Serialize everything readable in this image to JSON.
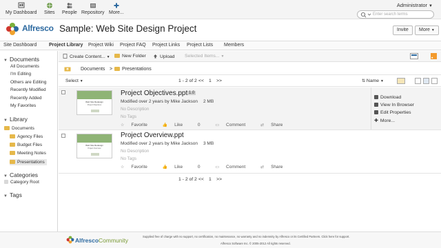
{
  "topnav": {
    "items": [
      {
        "label": "My Dashboard",
        "icon": "dashboard-icon"
      },
      {
        "label": "Sites",
        "icon": "sites-icon"
      },
      {
        "label": "People",
        "icon": "people-icon"
      },
      {
        "label": "Repository",
        "icon": "repository-icon"
      },
      {
        "label": "More...",
        "icon": "more-icon"
      }
    ],
    "user": "Administrator",
    "search_placeholder": "Enter search terms"
  },
  "header": {
    "logo_text": "Alfresco",
    "site_title": "Sample: Web Site Design Project",
    "invite_label": "Invite",
    "more_label": "More"
  },
  "sitenav": {
    "items": [
      "Site Dashboard",
      "Project Library",
      "Project Wiki",
      "Project FAQ",
      "Project Links",
      "Project Lists",
      "Members"
    ],
    "active": "Project Library"
  },
  "sidebar": {
    "documents_title": "Documents",
    "doc_filters": [
      "All Documents",
      "I'm Editing",
      "Others are Editing",
      "Recently Modified",
      "Recently Added",
      "My Favorites"
    ],
    "library_title": "Library",
    "library_root": "Documents",
    "folders": [
      "Agency Files",
      "Budget Files",
      "Meeting Notes",
      "Presentations"
    ],
    "selected_folder": "Presentations",
    "categories_title": "Categories",
    "category_root": "Category Root",
    "tags_title": "Tags"
  },
  "toolbar": {
    "create": "Create Content...",
    "new_folder": "New Folder",
    "upload": "Upload",
    "selected_items": "Selected Items..."
  },
  "path": {
    "root": "Documents",
    "current": "Presentations"
  },
  "listbar": {
    "select": "Select",
    "paging": "1 - 2 of 2",
    "prev": "<<",
    "page": "1",
    "next": ">>",
    "sort": "Name"
  },
  "files": [
    {
      "name": "Project Objectives.ppt",
      "version": "1.0",
      "modified": "Modified over 2 years by Mike Jackson",
      "size": "2 MB",
      "description": "No Description",
      "tags": "No Tags",
      "thumb_title": "Web Site Redesign",
      "thumb_subtitle": "Project Objectives"
    },
    {
      "name": "Project Overview.ppt",
      "modified": "Modified over 2 years by Mike Jackson",
      "size": "3 MB",
      "description": "No Description",
      "tags": "No Tags",
      "thumb_title": "Web Site Redesign",
      "thumb_subtitle": "Project Overview"
    }
  ],
  "row_actions": {
    "favorite": "Favorite",
    "like": "Like",
    "like_count": "0",
    "comment": "Comment",
    "share": "Share"
  },
  "action_panel": [
    "Download",
    "View In Browser",
    "Edit Properties",
    "More..."
  ],
  "footer": {
    "brand": "Alfresco",
    "brand_suffix": "Community",
    "line1": "Supplied free of charge with no support, no certification, no maintenance, no warranty and no indemnity by Alfresco or its Certified Partners. Click here for support.",
    "line2": "Alfresco Software Inc. © 2005-2012 All rights reserved."
  },
  "colors": {
    "brand_blue": "#2d6aa0",
    "brand_green": "#7a9a36",
    "folder": "#e6b84a"
  }
}
